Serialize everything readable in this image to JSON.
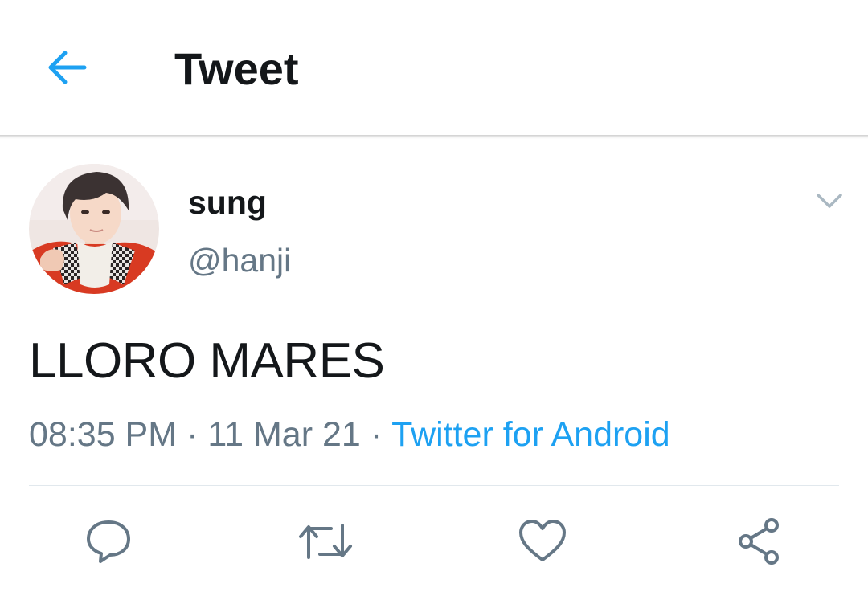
{
  "header": {
    "title": "Tweet",
    "back_icon": "back-arrow-icon",
    "accent_color": "#1da1f2"
  },
  "tweet": {
    "display_name": "sung",
    "handle": "@hanji",
    "text": "LLORO MARES",
    "time": "08:35 PM",
    "date": "11 Mar 21",
    "separator": "·",
    "source": "Twitter for Android",
    "caret_icon": "chevron-down-icon"
  },
  "actions": [
    {
      "name": "reply",
      "icon": "reply-icon"
    },
    {
      "name": "retweet",
      "icon": "retweet-icon"
    },
    {
      "name": "like",
      "icon": "heart-icon"
    },
    {
      "name": "share",
      "icon": "share-icon"
    }
  ],
  "colors": {
    "text_primary": "#14171a",
    "text_secondary": "#657786",
    "link": "#1da1f2",
    "divider": "#e1e8ed"
  }
}
